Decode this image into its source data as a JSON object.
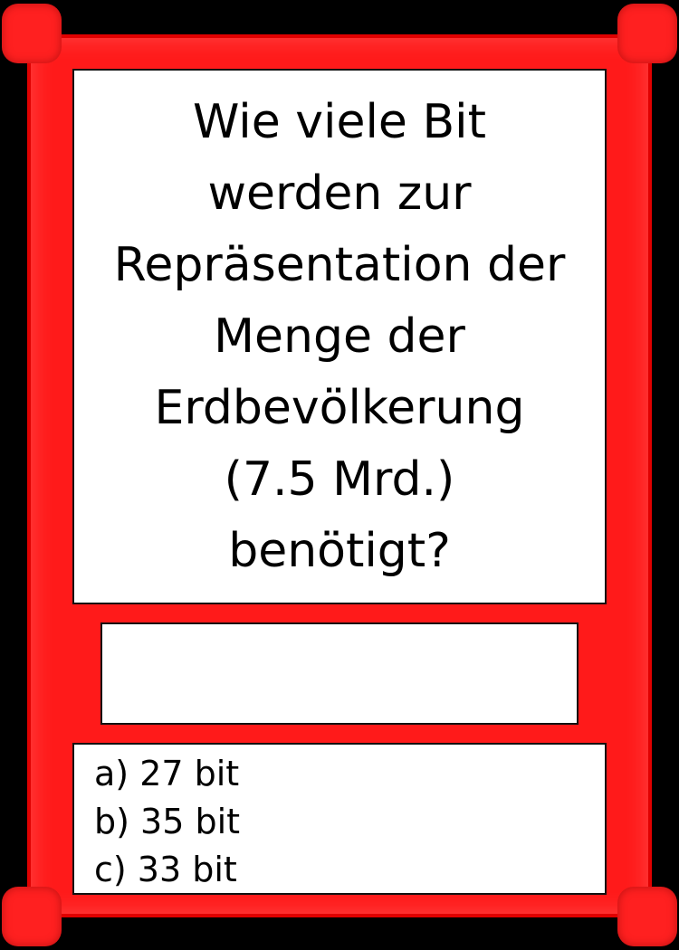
{
  "card": {
    "frame_color": "#ff1a1a",
    "question": "Wie viele Bit werden zur Repräsentation der Menge der Erdbevölkerung (7.5 Mrd.) benötigt?",
    "question_lines": [
      "Wie viele Bit",
      "werden zur",
      "Repräsentation der",
      "Menge der",
      "Erdbevölkerung",
      "(7.5 Mrd.)",
      "benötigt?"
    ],
    "answer": "",
    "options": [
      "a) 27 bit",
      "b) 35 bit",
      "c) 33 bit"
    ]
  }
}
